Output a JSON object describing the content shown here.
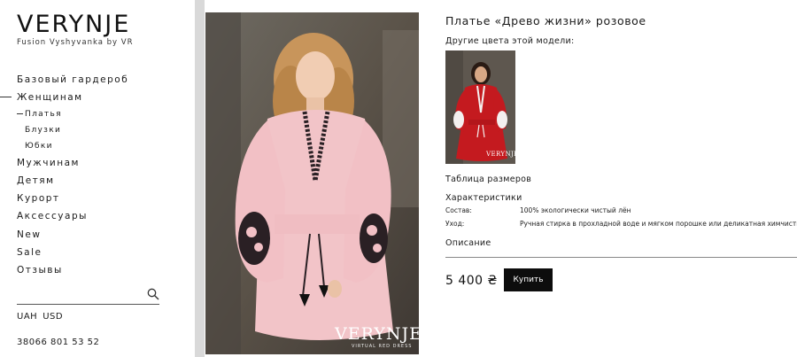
{
  "brand": {
    "name": "VERYNJE",
    "tagline": "Fusion Vyshyvanka by VR"
  },
  "nav": {
    "items": [
      {
        "label": "Базовый гардероб"
      },
      {
        "label": "Женщинам"
      },
      {
        "label": "Платья"
      },
      {
        "label": "Блузки"
      },
      {
        "label": "Юбки"
      },
      {
        "label": "Мужчинам"
      },
      {
        "label": "Детям"
      },
      {
        "label": "Курорт"
      },
      {
        "label": "Аксессуары"
      },
      {
        "label": "New"
      },
      {
        "label": "Sale"
      },
      {
        "label": "Отзывы"
      }
    ]
  },
  "search": {
    "placeholder": ""
  },
  "currency": {
    "uah": "UAH",
    "usd": "USD"
  },
  "contact": {
    "phone": "38066 801 53 52"
  },
  "photo": {
    "brand": "VERYNJE",
    "brand_sub": "VIRTUAL RED DRESS"
  },
  "product": {
    "title": "Платье «Древо жизни» розовое",
    "other_colors_label": "Другие цвета этой модели:",
    "thumb_brand": "VERYNJE",
    "size_table_label": "Таблица размеров",
    "characteristics_title": "Характеристики",
    "characteristics": [
      {
        "key": "Состав:",
        "value": "100% экологически чистый лён"
      },
      {
        "key": "Уход:",
        "value": "Ручная стирка в прохладной воде и мягком порошке или деликатная химчистка"
      }
    ],
    "description_label": "Описание",
    "price": "5 400 ₴",
    "buy_label": "Купить"
  },
  "colors": {
    "dress_pink": "#f2c4c8",
    "dress_red": "#c41a1f",
    "button": "#0d0d0d"
  }
}
